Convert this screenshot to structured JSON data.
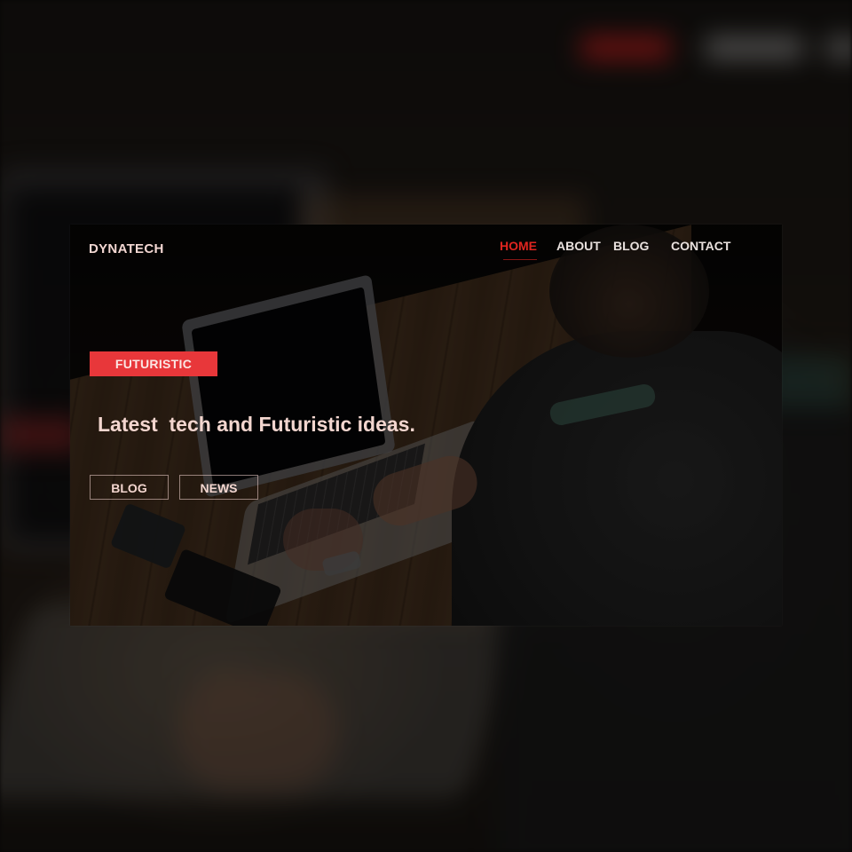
{
  "brand": "DYNATECH",
  "nav": {
    "items": [
      {
        "label": "HOME",
        "active": true
      },
      {
        "label": "ABOUT",
        "active": false
      },
      {
        "label": "BLOG",
        "active": false
      },
      {
        "label": "CONTACT",
        "active": false
      }
    ]
  },
  "hero": {
    "tag": "FUTURISTIC",
    "headline": "Latest  tech and Futuristic ideas.",
    "buttons": {
      "blog": "BLOG",
      "news": "NEWS"
    }
  },
  "colors": {
    "accent": "#e8373a",
    "nav_active": "#e0251f",
    "text": "#f3d6cf"
  }
}
